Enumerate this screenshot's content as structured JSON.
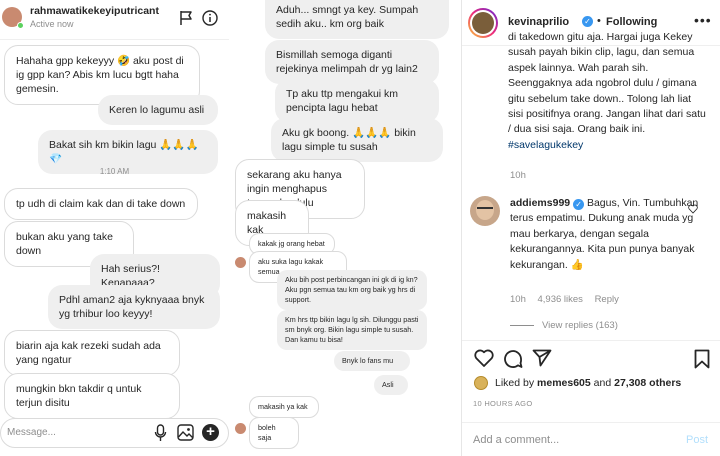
{
  "dm": {
    "username": "rahmawatikekeyiputricant",
    "status": "Active now",
    "col1_messages": [
      {
        "text": "Hahaha gpp kekeyyy 🤣 aku post di ig gpp kan? Abis km lucu bgtt haha gemesin.",
        "dir": "in"
      },
      {
        "text": "Keren lo lagumu asli",
        "dir": "out"
      },
      {
        "text": "Bakat sih km bikin lagu 🙏🙏🙏💎",
        "dir": "out"
      },
      {
        "text": "tp udh di claim kak dan di take down",
        "dir": "in"
      },
      {
        "text": "bukan aku yang take down",
        "dir": "in"
      },
      {
        "text": "Hah serius?! Kenapaaa?",
        "dir": "out"
      },
      {
        "text": "Pdhl aman2 aja kyknyaaa bnyk yg trhibur loo keyyy!",
        "dir": "out"
      },
      {
        "text": "biarin aja kak rezeki sudah ada yang ngatur",
        "dir": "in"
      },
      {
        "text": "mungkin bkn takdir q untuk terjun disitu",
        "dir": "in"
      }
    ],
    "timestamp": "1:10 AM",
    "composer_placeholder": "Message...",
    "col2_messages": [
      {
        "text": "Aduh... smngt ya key. Sumpah sedih aku.. km org baik",
        "dir": "out"
      },
      {
        "text": "Bismillah semoga diganti rejekinya melimpah dr yg lain2",
        "dir": "out"
      },
      {
        "text": "Tp aku ttp mengakui km pencipta lagu hebat",
        "dir": "out"
      },
      {
        "text": "Aku gk boong. 🙏🙏🙏 bikin lagu simple tu susah",
        "dir": "out"
      },
      {
        "text": "sekarang aku hanya ingin menghapus traumaku dulu",
        "dir": "in"
      },
      {
        "text": "makasih kak",
        "dir": "in"
      },
      {
        "text": "kakak jg orang hebat",
        "dir": "in"
      },
      {
        "text": "aku suka lagu kakak semua",
        "dir": "in"
      },
      {
        "text": "Aku bih post perbincangan ini gk di ig kn? Aku pgn semua tau km org baik yg hrs di support.",
        "dir": "out"
      },
      {
        "text": "Km hrs ttp bikin lagu lg sih. Dilunggu pasti sm bnyk org. Bikin lagu simple tu susah. Dan kamu tu bisa!",
        "dir": "out"
      },
      {
        "text": "Bnyk lo fans mu",
        "dir": "out"
      },
      {
        "text": "Asli",
        "dir": "out"
      },
      {
        "text": "makasih ya kak",
        "dir": "in"
      },
      {
        "text": "boleh saja",
        "dir": "in"
      }
    ]
  },
  "post": {
    "username": "kevinaprilio",
    "follow_state": "Following",
    "caption_text": "di takedown gitu aja. Hargai juga Kekey susah payah bikin clip, lagu, dan semua aspek lainnya. Wah parah sih. Seenggaknya ada ngobrol dulu / gimana gitu sebelum take down.. Tolong lah liat sisi positifnya orang. Jangan lihat dari satu / dua sisi saja. Orang baik ini.",
    "caption_tag": "#savelagukekey",
    "caption_age": "10h",
    "comment": {
      "username": "addiems999",
      "text": "Bagus, Vin. Tumbuhkan terus empatimu. Dukung anak muda yg mau berkarya, dengan segala kekurangannya. Kita pun punya banyak kekurangan. 👍",
      "age": "10h",
      "likes": "4,936 likes",
      "reply": "Reply",
      "view_replies": "View replies (163)"
    },
    "liked_by_prefix": "Liked by",
    "liked_by_user": "memes605",
    "liked_by_and": "and",
    "liked_by_others": "27,308 others",
    "time_ago": "10 HOURS AGO",
    "add_comment_placeholder": "Add a comment...",
    "post_button": "Post"
  },
  "colors": {
    "link": "#00376b",
    "verified": "#3897f0",
    "post_button": "#b2dffc",
    "active": "#5bd15e"
  },
  "icons": [
    "flag-icon",
    "info-icon",
    "mic-icon",
    "photo-icon",
    "plus-icon",
    "more-icon",
    "heart-icon",
    "comment-icon",
    "share-icon",
    "save-icon"
  ]
}
